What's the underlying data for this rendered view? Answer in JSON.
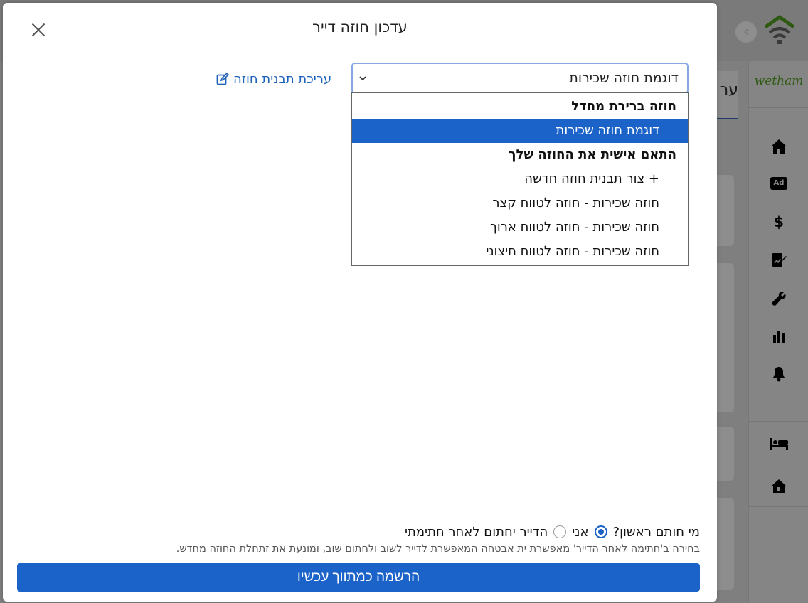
{
  "modal": {
    "title": "עדכון חוזה דייר",
    "edit_template_label": "עריכת תבנית חוזה",
    "select": {
      "value": "דוגמת חוזה שכירות",
      "options": [
        {
          "label": "חוזה ברירת מחדל",
          "kind": "group"
        },
        {
          "label": "דוגמת חוזה שכירות",
          "kind": "selected"
        },
        {
          "label": "התאם אישית את החוזה שלך",
          "kind": "group"
        },
        {
          "label": "+ צור תבנית חוזה חדשה",
          "kind": "option"
        },
        {
          "label": "חוזה שכירות - חוזה לטווח קצר",
          "kind": "option"
        },
        {
          "label": "חוזה שכירות - חוזה לטווח ארוך",
          "kind": "option"
        },
        {
          "label": "חוזה שכירות - חוזה לטווח חיצוני",
          "kind": "option"
        }
      ]
    },
    "signer": {
      "question": "מי חותם ראשון?",
      "option_me": "אני",
      "option_tenant": "הדייר יחתום לאחר חתימתי",
      "selected": "me"
    },
    "note": "בחירה ב'חתימה לאחר הדייר' מאפשרת ית אבטחה המאפשרת לדייר לשוב ולחתום שוב, ומונעת את זתחלת החוזה מחדש.",
    "submit_label": "הרשמה כמתווך עכשיו"
  },
  "background": {
    "brand": "wetham",
    "tab_label": "ער",
    "sidebar_icons": [
      "home-icon",
      "ad-icon",
      "dollar-icon",
      "contract-icon",
      "wrench-icon",
      "chart-icon",
      "bell-icon",
      "bed-icon",
      "house-icon"
    ]
  },
  "colors": {
    "primary": "#1b63c9",
    "link": "#1f62b9",
    "overlay": "#7f7f7f"
  }
}
